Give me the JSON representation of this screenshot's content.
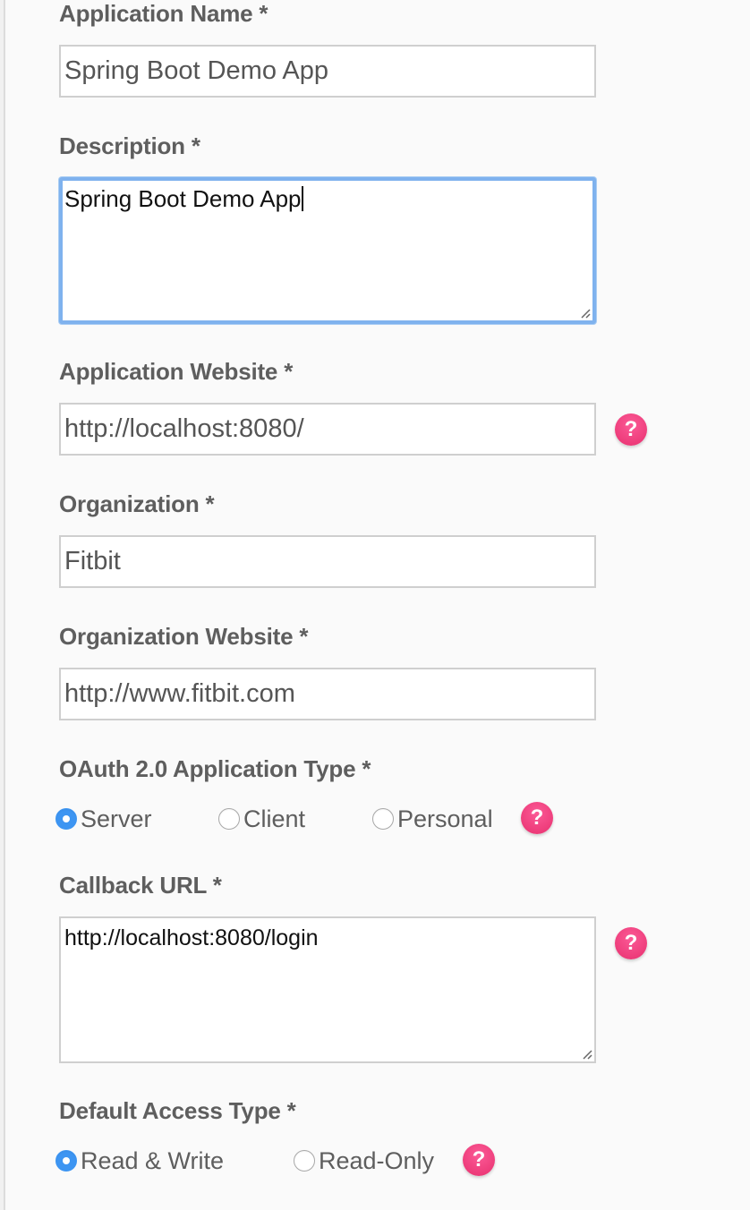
{
  "form": {
    "application_name": {
      "label": "Application Name *",
      "value": "Spring Boot Demo App"
    },
    "description": {
      "label": "Description *",
      "value": "Spring Boot Demo App"
    },
    "application_website": {
      "label": "Application Website *",
      "value": "http://localhost:8080/"
    },
    "organization": {
      "label": "Organization *",
      "value": "Fitbit"
    },
    "organization_website": {
      "label": "Organization Website *",
      "value": "http://www.fitbit.com"
    },
    "oauth_type": {
      "label": "OAuth 2.0 Application Type *",
      "options": [
        "Server",
        "Client",
        "Personal"
      ],
      "selected": "Server"
    },
    "callback_url": {
      "label": "Callback URL *",
      "value": "http://localhost:8080/login"
    },
    "default_access_type": {
      "label": "Default Access Type *",
      "options": [
        "Read & Write",
        "Read-Only"
      ],
      "selected": "Read & Write"
    },
    "help_glyph": "?"
  },
  "colors": {
    "accent_focus": "#7fb2ee",
    "radio_selected": "#3d95f2",
    "help_icon": "#f0407e",
    "label": "#5e5e5e"
  }
}
